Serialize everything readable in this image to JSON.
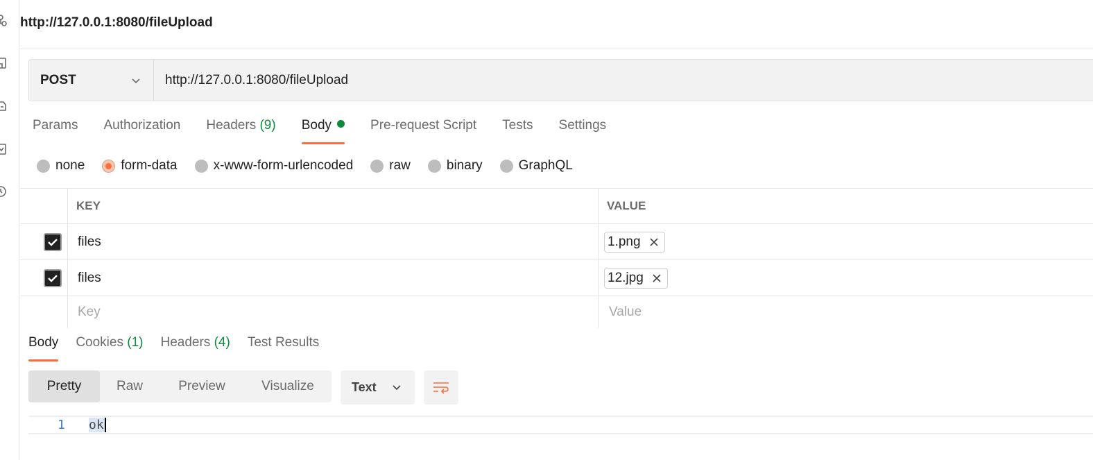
{
  "request": {
    "title": "http://127.0.0.1:8080/fileUpload",
    "method": "POST",
    "url": "http://127.0.0.1:8080/fileUpload"
  },
  "request_tabs": [
    {
      "label": "Params"
    },
    {
      "label": "Authorization"
    },
    {
      "label": "Headers",
      "count": "(9)"
    },
    {
      "label": "Body",
      "indicator": "modified-dot"
    },
    {
      "label": "Pre-request Script"
    },
    {
      "label": "Tests"
    },
    {
      "label": "Settings"
    }
  ],
  "active_request_tab": "Body",
  "body_types": [
    {
      "label": "none",
      "selected": false
    },
    {
      "label": "form-data",
      "selected": true
    },
    {
      "label": "x-www-form-urlencoded",
      "selected": false
    },
    {
      "label": "raw",
      "selected": false
    },
    {
      "label": "binary",
      "selected": false
    },
    {
      "label": "GraphQL",
      "selected": false
    }
  ],
  "form_table": {
    "headers": {
      "key": "KEY",
      "value": "VALUE"
    },
    "rows": [
      {
        "checked": true,
        "key": "files",
        "file": "1.png"
      },
      {
        "checked": true,
        "key": "files",
        "file": "12.jpg"
      }
    ],
    "new_row": {
      "key_placeholder": "Key",
      "value_placeholder": "Value"
    }
  },
  "response_tabs": [
    {
      "label": "Body"
    },
    {
      "label": "Cookies",
      "count": "(1)"
    },
    {
      "label": "Headers",
      "count": "(4)"
    },
    {
      "label": "Test Results"
    }
  ],
  "active_response_tab": "Body",
  "view_modes": [
    {
      "label": "Pretty",
      "active": true
    },
    {
      "label": "Raw",
      "active": false
    },
    {
      "label": "Preview",
      "active": false
    },
    {
      "label": "Visualize",
      "active": false
    }
  ],
  "format": "Text",
  "icons": {
    "wrap": "wrap-lines-icon",
    "dropdown": "chevron-down-icon",
    "remove": "close-icon",
    "check": "check-icon"
  },
  "response_body": {
    "line_number": "1",
    "content": "ok"
  },
  "colors": {
    "accent": "#ff6c37",
    "count_green": "#0d8a3c"
  }
}
